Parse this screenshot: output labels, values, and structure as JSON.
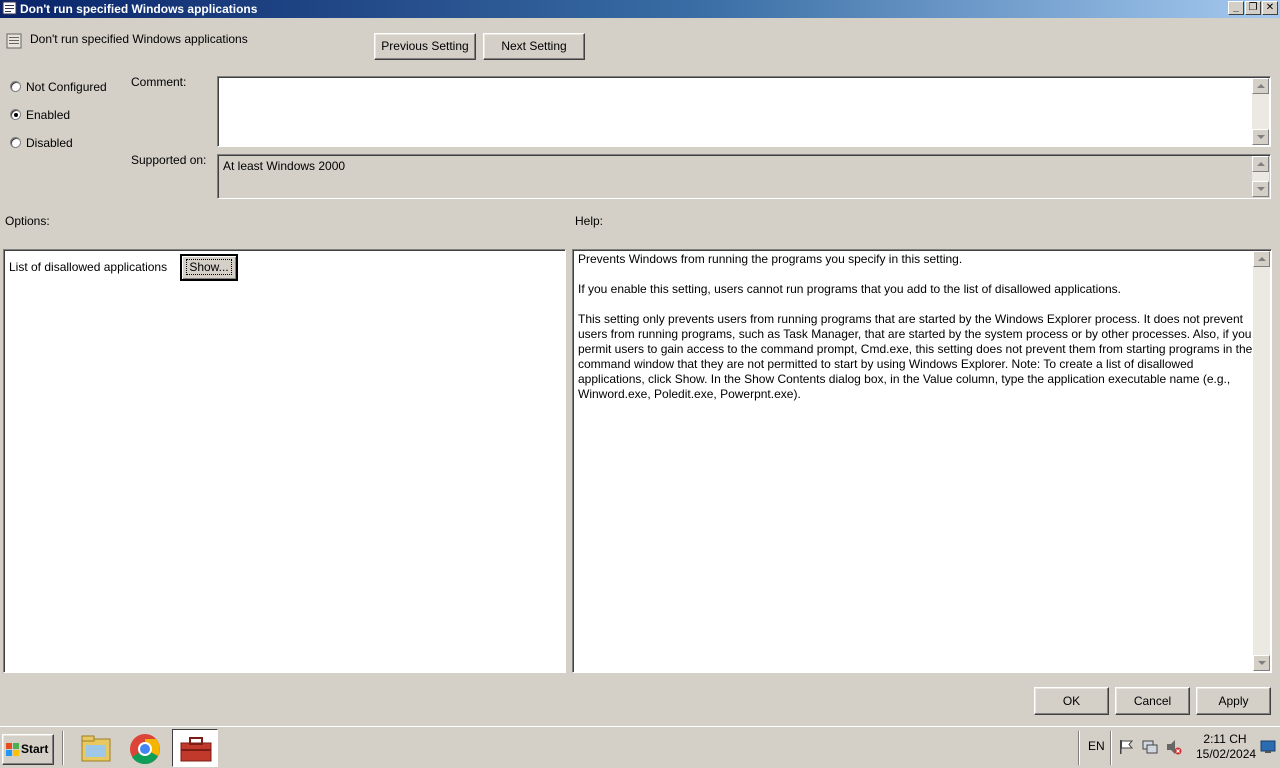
{
  "window": {
    "title": "Don't run specified Windows applications",
    "policy_name": "Don't run specified Windows applications",
    "controls": [
      "minimize",
      "restore",
      "close"
    ]
  },
  "nav": {
    "previous_label": "Previous Setting",
    "next_label": "Next Setting"
  },
  "state": {
    "options": [
      {
        "label": "Not Configured",
        "selected": false
      },
      {
        "label": "Enabled",
        "selected": true
      },
      {
        "label": "Disabled",
        "selected": false
      }
    ]
  },
  "comment": {
    "label": "Comment:",
    "value": ""
  },
  "supported": {
    "label": "Supported on:",
    "value": "At least Windows 2000"
  },
  "options_section": {
    "label": "Options:",
    "list_label": "List of disallowed applications",
    "show_label": "Show..."
  },
  "help_section": {
    "label": "Help:",
    "paragraphs": [
      "Prevents Windows from running the programs you specify in this setting.",
      "If you enable this setting, users cannot run programs that you add to the list of disallowed applications.",
      "This setting only prevents users from running programs that are started by the Windows Explorer process. It does not prevent users from running programs, such as Task Manager, that are started by the system process or by other processes. Also, if you permit users to gain access to the command prompt, Cmd.exe, this setting does not prevent them from starting programs in the command window that they are not permitted to start by using Windows Explorer. Note: To create a list of disallowed applications, click Show. In the Show Contents dialog box, in the Value column, type the application executable name (e.g., Winword.exe, Poledit.exe, Powerpnt.exe)."
    ]
  },
  "footer": {
    "ok_label": "OK",
    "cancel_label": "Cancel",
    "apply_label": "Apply"
  },
  "taskbar": {
    "start_label": "Start",
    "apps": [
      "file-explorer",
      "chrome",
      "toolbox"
    ],
    "language": "EN",
    "time": "2:11 CH",
    "date": "15/02/2024"
  },
  "colors": {
    "titlebar_start": "#0a246a",
    "titlebar_end": "#a6caf0",
    "face": "#d4d0c8"
  }
}
